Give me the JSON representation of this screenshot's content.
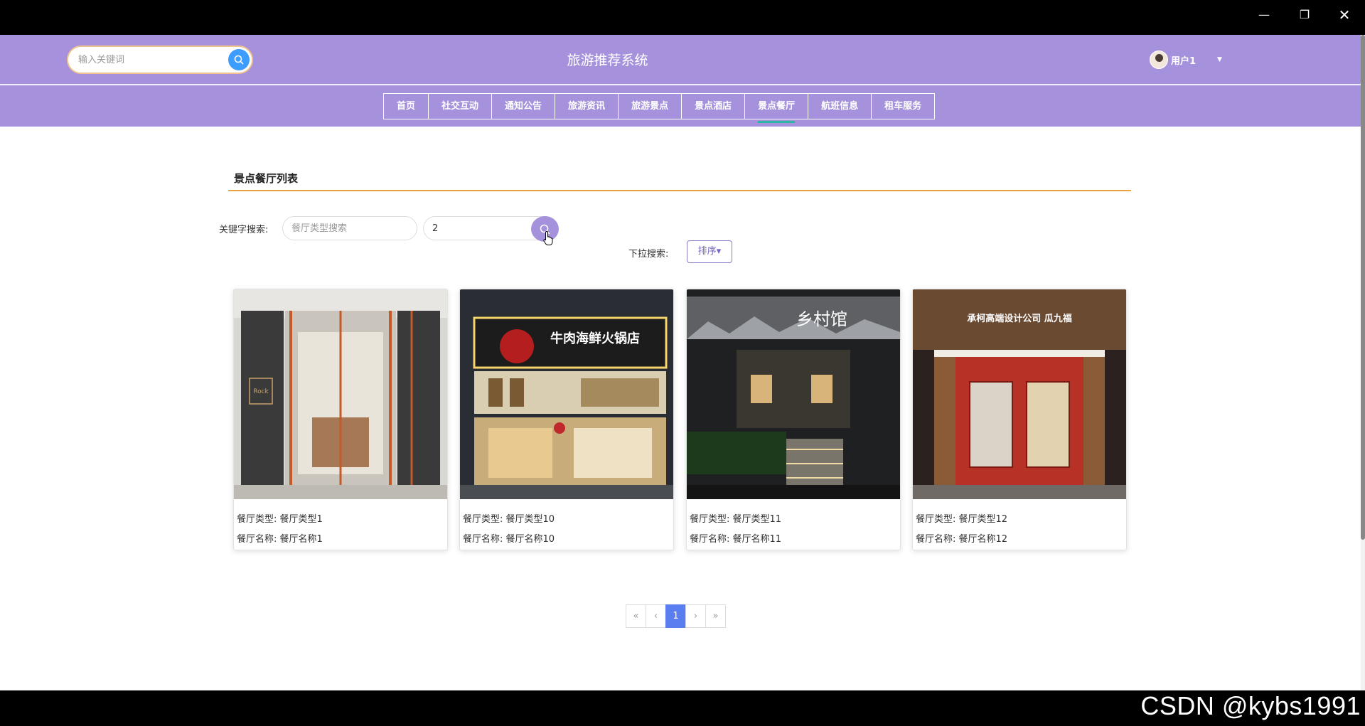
{
  "window": {
    "minimize": "—",
    "maximize": "❐",
    "close": "✕"
  },
  "header": {
    "search_placeholder": "输入关键词",
    "site_title": "旅游推荐系统",
    "user_name": "用户1",
    "user_caret": "▼"
  },
  "nav": {
    "items": [
      {
        "label": "首页"
      },
      {
        "label": "社交互动"
      },
      {
        "label": "通知公告"
      },
      {
        "label": "旅游资讯"
      },
      {
        "label": "旅游景点"
      },
      {
        "label": "景点酒店"
      },
      {
        "label": "景点餐厅"
      },
      {
        "label": "航班信息"
      },
      {
        "label": "租车服务"
      }
    ],
    "active_index": 6
  },
  "content": {
    "section_title": "景点餐厅列表",
    "keyword_label": "关键字搜索:",
    "type_placeholder": "餐厅类型搜索",
    "name_value": "2",
    "dropdown_label": "下拉搜索:",
    "sort_label": "排序",
    "sort_caret": "▾"
  },
  "cards": [
    {
      "type_label": "餐厅类型:",
      "type": "餐厅类型1",
      "name_label": "餐厅名称:",
      "name": "餐厅名称1",
      "sign": "Rock"
    },
    {
      "type_label": "餐厅类型:",
      "type": "餐厅类型10",
      "name_label": "餐厅名称:",
      "name": "餐厅名称10",
      "sign": "牛肉海鲜火锅店"
    },
    {
      "type_label": "餐厅类型:",
      "type": "餐厅类型11",
      "name_label": "餐厅名称:",
      "name": "餐厅名称11",
      "sign": "乡村馆"
    },
    {
      "type_label": "餐厅类型:",
      "type": "餐厅类型12",
      "name_label": "餐厅名称:",
      "name": "餐厅名称12",
      "sign": "承柯高端设计公司 瓜九福"
    }
  ],
  "pagination": {
    "first": "«",
    "prev": "‹",
    "current": "1",
    "next": "›",
    "last": "»"
  },
  "watermark": "CSDN @kybs1991",
  "colors": {
    "header_bg": "#a692dc",
    "search_btn": "#3c9cff",
    "title_underline": "#e8a23d",
    "active_page": "#5a7df0"
  }
}
